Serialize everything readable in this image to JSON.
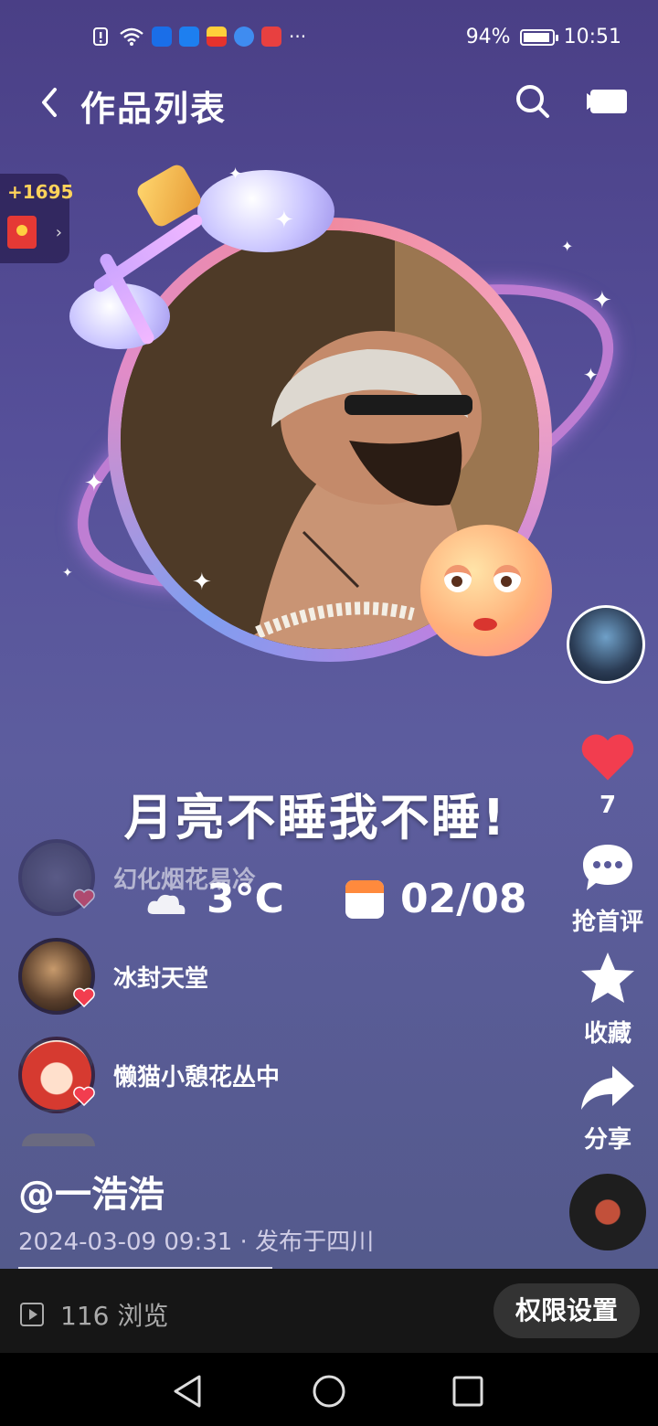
{
  "status_bar": {
    "battery_percent_text": "94%",
    "battery_level": 0.94,
    "time": "10:51",
    "more_indicator": "···",
    "notification_icons": [
      "alert-icon",
      "wifi-icon",
      "shield-app-icon",
      "bulb-app-icon",
      "news-app-icon",
      "browser-app-icon",
      "book-app-icon"
    ]
  },
  "header": {
    "title": "作品列表",
    "back_icon": "back-arrow-icon",
    "search_icon": "search-icon",
    "camera_icon": "video-camera-icon"
  },
  "red_packet": {
    "amount": "+1695",
    "arrow": "›"
  },
  "post": {
    "caption": "月亮不睡我不睡!",
    "temperature": "3°C",
    "date": "02/08"
  },
  "likers": [
    {
      "name": "幻化烟花易冷"
    },
    {
      "name": "冰封天堂"
    },
    {
      "name": "懒猫小憩花丛中"
    }
  ],
  "right_column": {
    "like_count": "7",
    "comment_label": "抢首评",
    "favorite_label": "收藏",
    "share_label": "分享"
  },
  "author": {
    "handle": "@一浩浩",
    "meta": "2024-03-09 09:31 · 发布于四川"
  },
  "bottom_bar": {
    "views": "116 浏览",
    "permission_button": "权限设置"
  },
  "colors": {
    "background_top": "#4a3f86",
    "heart": "#f23d4f",
    "red_packet_amount": "#ffd35a"
  }
}
